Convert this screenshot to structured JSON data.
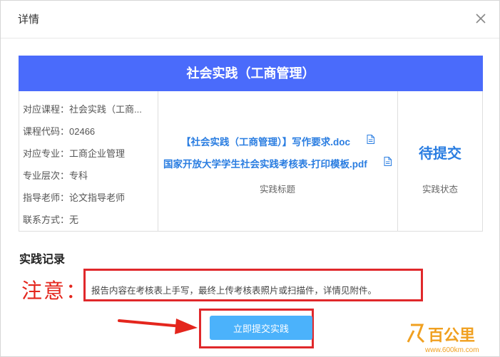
{
  "dialog": {
    "title": "详情",
    "close_icon": "close-icon"
  },
  "banner": {
    "title": "社会实践（工商管理）"
  },
  "info": [
    "对应课程：社会实践（工商...",
    "课程代码：02466",
    "对应专业：工商企业管理",
    "专业层次：专科",
    "指导老师：论文指导老师",
    "联系方式：无"
  ],
  "files": [
    {
      "name": "【社会实践（工商管理）】写作要求.doc",
      "icon": "document-icon"
    },
    {
      "name": "国家开放大学学生社会实践考核表-打印模板.pdf",
      "icon": "document-icon"
    }
  ],
  "mid_label": "实践标题",
  "status": {
    "value": "待提交",
    "label": "实践状态"
  },
  "section_title": "实践记录",
  "note": {
    "label": "注意：",
    "text": "报告内容在考核表上手写，最终上传考核表照片或扫描件，详情见附件。"
  },
  "submit_label": "立即提交实践",
  "watermark": {
    "brand": "百公里",
    "url": "www.600km.com"
  },
  "colors": {
    "banner": "#4a6bfb",
    "link": "#2a7de1",
    "annotation": "#e0282b",
    "button": "#4bb2fb"
  }
}
